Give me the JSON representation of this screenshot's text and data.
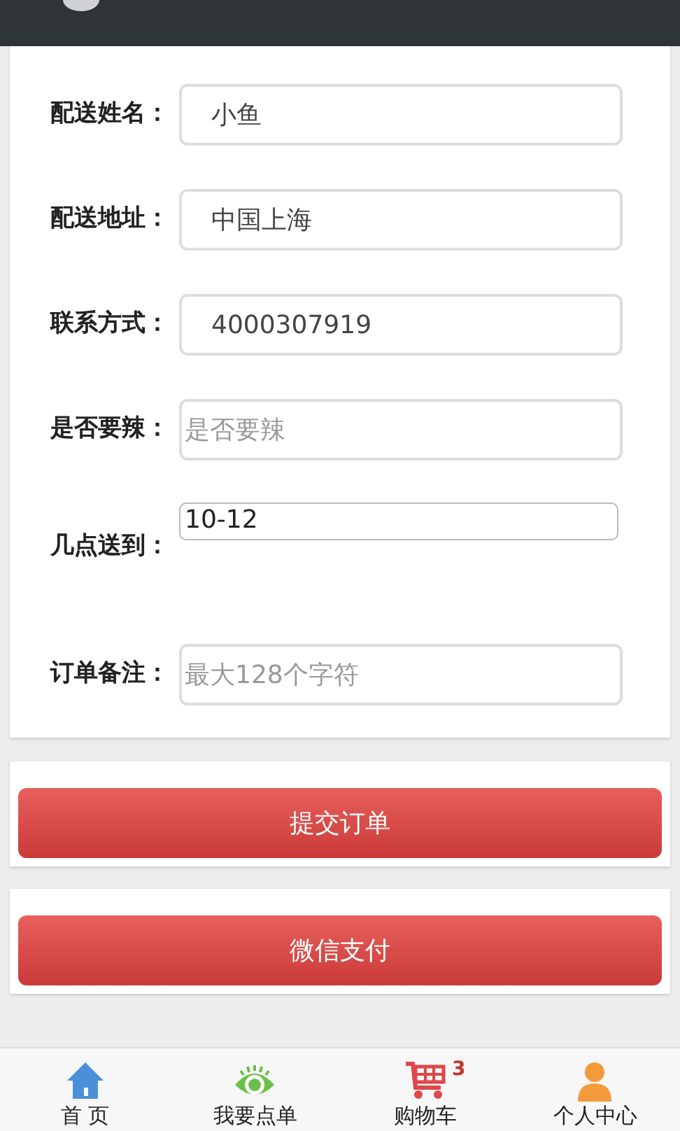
{
  "form": {
    "fields": [
      {
        "label": "配送姓名：",
        "kind": "input",
        "value": "小鱼"
      },
      {
        "label": "配送地址：",
        "kind": "input",
        "value": "中国上海"
      },
      {
        "label": "联系方式：",
        "kind": "input",
        "value": "4000307919"
      },
      {
        "label": "是否要辣：",
        "kind": "input",
        "placeholder": "是否要辣"
      },
      {
        "label": "几点送到：",
        "kind": "select",
        "value": "10-12"
      },
      {
        "label": "订单备注：",
        "kind": "input",
        "placeholder": "最大128个字符"
      }
    ]
  },
  "buttons": [
    "提交订单",
    "微信支付"
  ],
  "bottom_nav": [
    {
      "label": "首 页",
      "kind": "home"
    },
    {
      "label": "我要点单",
      "kind": "eye"
    },
    {
      "label": "购物车",
      "kind": "cart",
      "badge": "3"
    },
    {
      "label": "个人中心",
      "kind": "person"
    }
  ]
}
